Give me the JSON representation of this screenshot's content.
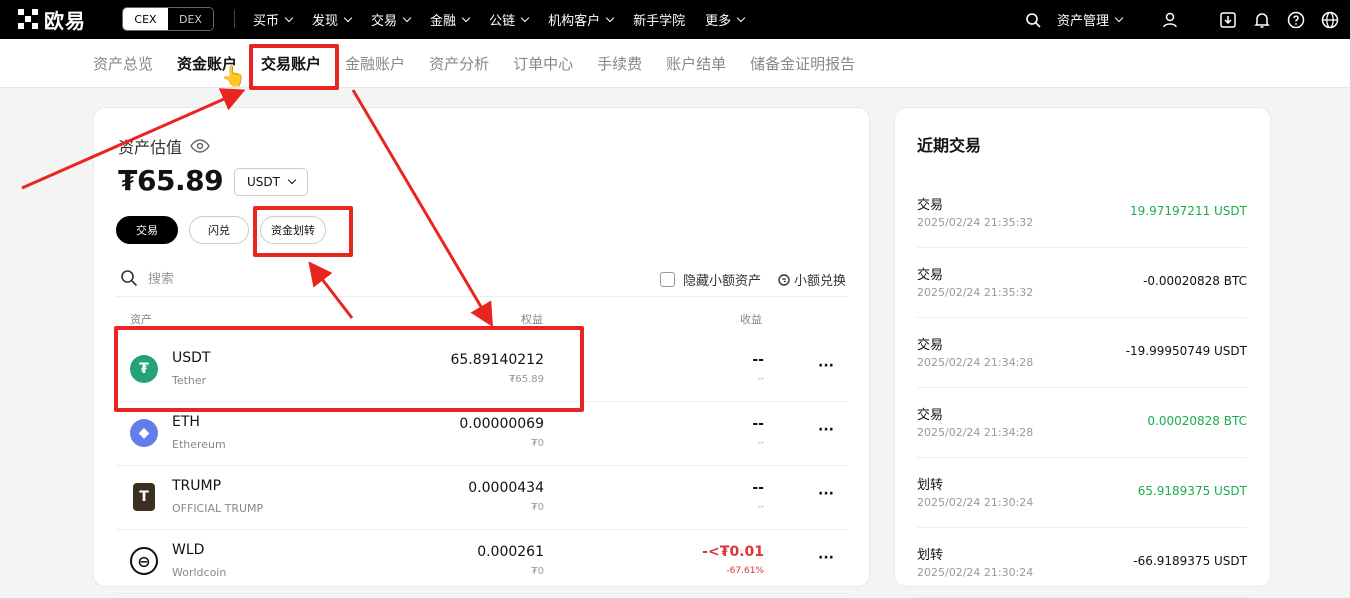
{
  "top": {
    "logo_text": "欧易",
    "cex": "CEX",
    "dex": "DEX",
    "nav": [
      {
        "label": "买币"
      },
      {
        "label": "发现"
      },
      {
        "label": "交易"
      },
      {
        "label": "金融"
      },
      {
        "label": "公链"
      },
      {
        "label": "机构客户"
      },
      {
        "label": "新手学院"
      },
      {
        "label": "更多"
      }
    ],
    "asset_mgmt": "资产管理"
  },
  "subnav": [
    "资产总览",
    "资金账户",
    "交易账户",
    "金融账户",
    "资产分析",
    "订单中心",
    "手续费",
    "账户结单",
    "储备金证明报告"
  ],
  "main": {
    "est_label": "资产估值",
    "balance": "₮65.89",
    "currency": "USDT",
    "btn_trade": "交易",
    "btn_flash": "闪兑",
    "btn_transfer": "资金划转",
    "search_placeholder": "搜索",
    "hide_small": "隐藏小额资产",
    "small_swap": "小额兑换",
    "col_asset": "资产",
    "col_equity": "权益",
    "col_pnl": "收益",
    "more": "···",
    "rows": [
      {
        "symbol": "USDT",
        "name": "Tether",
        "equity": "65.89140212",
        "equity_sub": "₮65.89",
        "pnl": "--",
        "pnl_sub": "--",
        "icon": "usdt-icon",
        "color": "#26a17b",
        "glyph": "₮"
      },
      {
        "symbol": "ETH",
        "name": "Ethereum",
        "equity": "0.00000069",
        "equity_sub": "₮0",
        "pnl": "--",
        "pnl_sub": "--",
        "icon": "eth-icon",
        "color": "#627eea",
        "glyph": "◆"
      },
      {
        "symbol": "TRUMP",
        "name": "OFFICIAL TRUMP",
        "equity": "0.0000434",
        "equity_sub": "₮0",
        "pnl": "--",
        "pnl_sub": "--",
        "icon": "trump-icon",
        "color": "#3b3020",
        "glyph": "T"
      },
      {
        "symbol": "WLD",
        "name": "Worldcoin",
        "equity": "0.000261",
        "equity_sub": "₮0",
        "pnl": "-<₮0.01",
        "pnl_sub": "-67.61%",
        "icon": "wld-icon",
        "color": "#111111",
        "glyph": "⊖"
      }
    ]
  },
  "recent": {
    "title": "近期交易",
    "items": [
      {
        "type": "交易",
        "time": "2025/02/24 21:35:32",
        "amount": "19.97197211 USDT",
        "positive": true
      },
      {
        "type": "交易",
        "time": "2025/02/24 21:35:32",
        "amount": "-0.00020828 BTC",
        "positive": false
      },
      {
        "type": "交易",
        "time": "2025/02/24 21:34:28",
        "amount": "-19.99950749 USDT",
        "positive": false
      },
      {
        "type": "交易",
        "time": "2025/02/24 21:34:28",
        "amount": "0.00020828 BTC",
        "positive": true
      },
      {
        "type": "划转",
        "time": "2025/02/24 21:30:24",
        "amount": "65.9189375 USDT",
        "positive": true
      },
      {
        "type": "划转",
        "time": "2025/02/24 21:30:24",
        "amount": "-66.9189375 USDT",
        "positive": false
      }
    ]
  },
  "colors": {
    "accent_red": "#e8261f",
    "green": "#1aad4d"
  }
}
